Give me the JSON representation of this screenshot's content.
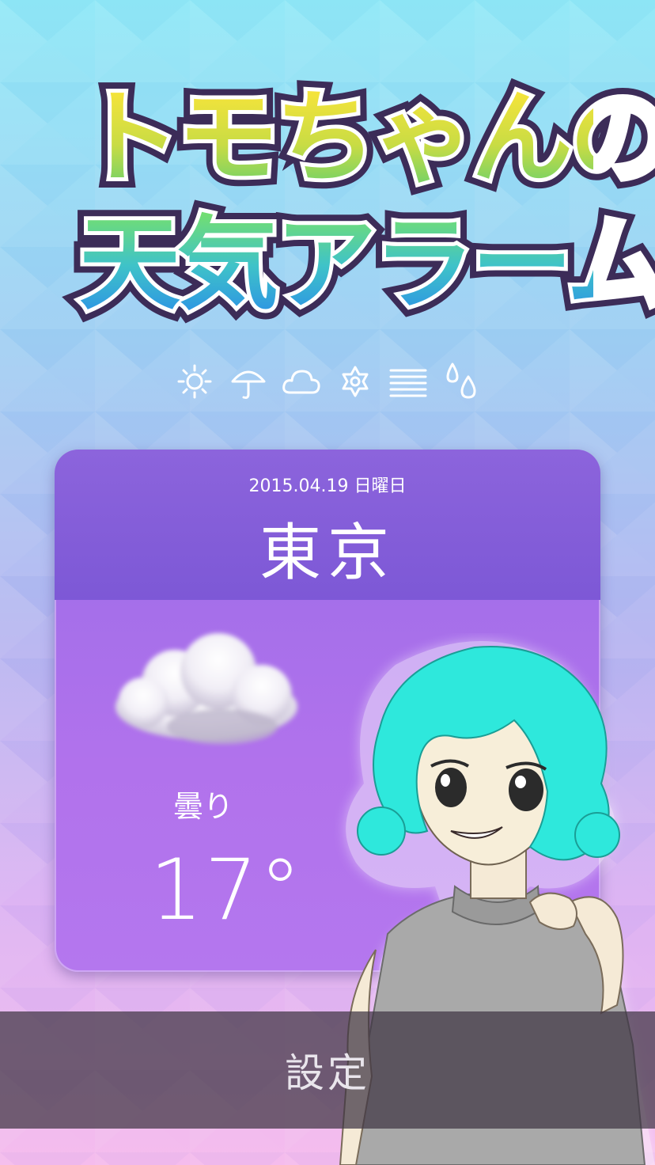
{
  "app": {
    "logo_line_1": "トモちゃんの",
    "logo_line_2": "天気アラーム"
  },
  "weather_icons": [
    "sun-icon",
    "umbrella-icon",
    "cloud-icon",
    "snow-icon",
    "fog-icon",
    "raindrops-icon"
  ],
  "card": {
    "date": "2015.04.19 日曜日",
    "city": "東京",
    "condition": "曇り",
    "temperature": "17°"
  },
  "settings": {
    "label": "設定"
  },
  "colors": {
    "card_header": "#7d58d6",
    "card_body": "#b172ec",
    "hair": "#2ee8dc",
    "settings_bar": "#3e3442"
  }
}
